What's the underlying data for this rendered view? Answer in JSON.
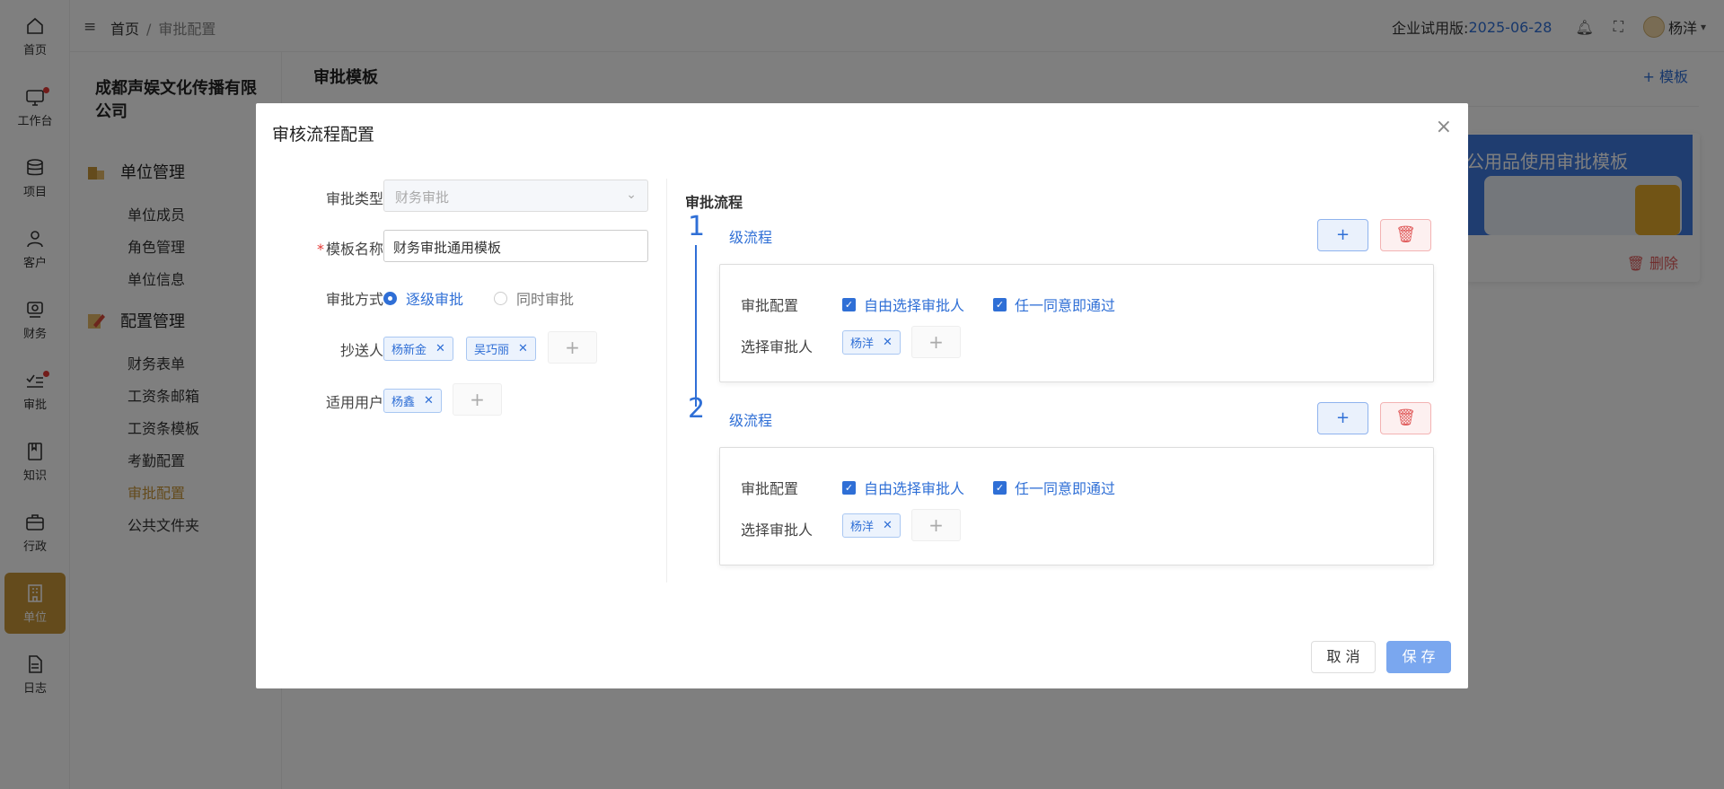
{
  "rail": [
    {
      "label": "首页",
      "icon": "home-icon"
    },
    {
      "label": "工作台",
      "icon": "monitor-icon",
      "dot": true
    },
    {
      "label": "项目",
      "icon": "database-icon"
    },
    {
      "label": "客户",
      "icon": "user-icon"
    },
    {
      "label": "财务",
      "icon": "finance-icon"
    },
    {
      "label": "审批",
      "icon": "approval-icon",
      "dot": true
    },
    {
      "label": "知识",
      "icon": "book-icon"
    },
    {
      "label": "行政",
      "icon": "briefcase-icon"
    },
    {
      "label": "单位",
      "icon": "building-icon",
      "active": true
    },
    {
      "label": "日志",
      "icon": "document-icon"
    }
  ],
  "topbar": {
    "breadcrumb_home": "首页",
    "breadcrumb_sep": "/",
    "breadcrumb_current": "审批配置",
    "trial_label": "企业试用版:",
    "trial_date": "2025-06-28",
    "user_name": "杨洋"
  },
  "sidebar": {
    "company": "成都声娱文化传播有限公司",
    "group1": {
      "title": "单位管理",
      "items": [
        "单位成员",
        "角色管理",
        "单位信息"
      ]
    },
    "group2": {
      "title": "配置管理",
      "items": [
        "财务表单",
        "工资条邮箱",
        "工资条模板",
        "考勤配置",
        "审批配置",
        "公共文件夹"
      ],
      "active_index": 4
    }
  },
  "content": {
    "title": "审批模板",
    "add_label": "+ 模板",
    "card_title": "公用品使用审批模板",
    "card_delete": "删除"
  },
  "dialog": {
    "title": "审核流程配置",
    "approval_type_label": "审批类型",
    "approval_type_value": "财务审批",
    "template_name_label": "模板名称",
    "template_name_value": "财务审批通用模板",
    "method_label": "审批方式",
    "method_options": [
      "逐级审批",
      "同时审批"
    ],
    "method_selected": 0,
    "cc_label": "抄送人",
    "cc_tags": [
      "杨新金",
      "吴巧丽"
    ],
    "users_label": "适用用户",
    "users_tags": [
      "杨鑫"
    ],
    "flow_title": "审批流程",
    "levels": [
      {
        "number": "1",
        "label": "级流程",
        "config_label": "审批配置",
        "opt1": "自由选择审批人",
        "opt2": "任一同意即通过",
        "approver_label": "选择审批人",
        "approvers": [
          "杨洋"
        ]
      },
      {
        "number": "2",
        "label": "级流程",
        "config_label": "审批配置",
        "opt1": "自由选择审批人",
        "opt2": "任一同意即通过",
        "approver_label": "选择审批人",
        "approvers": [
          "杨洋"
        ]
      }
    ],
    "cancel_label": "取 消",
    "save_label": "保 存"
  }
}
